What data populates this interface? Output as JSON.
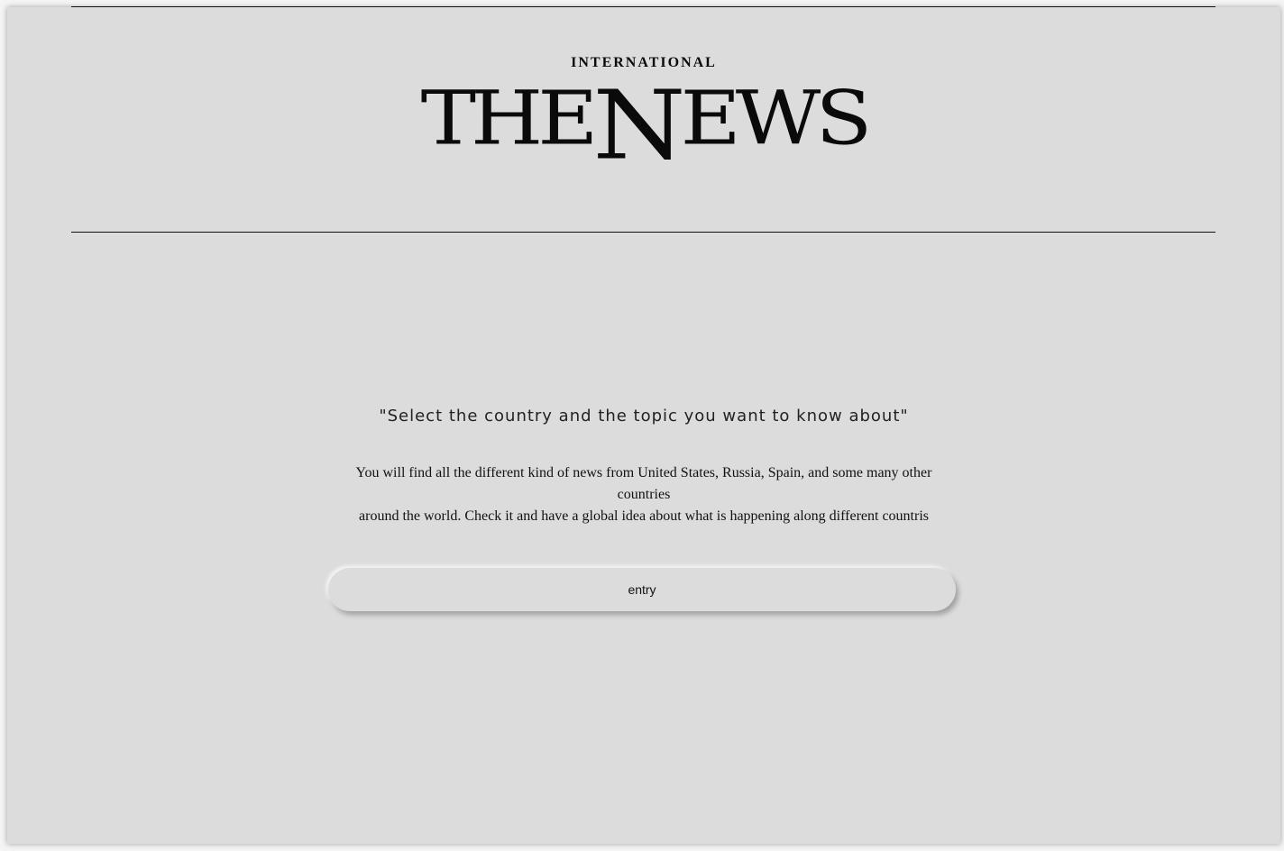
{
  "masthead": {
    "kicker": "INTERNATIONAL",
    "logo_part1": "THE",
    "logo_tall": "N",
    "logo_part2": "EWS"
  },
  "tagline": "\"Select the country and the topic you want to know about\"",
  "intro_line1": "You will find all the different kind of news from United States, Russia, Spain, and some many other countries",
  "intro_line2": "around the world. Check it and have a global idea about what is happening along different countris",
  "entry_button": {
    "label": "entry"
  }
}
